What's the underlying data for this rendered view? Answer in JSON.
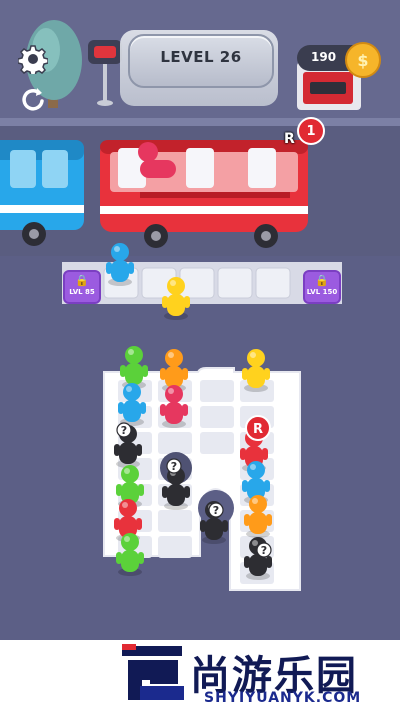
{
  "hud": {
    "level_label": "LEVEL 26",
    "coins": "190",
    "coin_symbol": "$",
    "settings_icon": "gear-icon",
    "restart_icon": "restart-icon"
  },
  "bus": {
    "badge_count": "1",
    "badge_type": "R",
    "color": "#e8323c"
  },
  "waiting_slots": {
    "locked_left_label": "LVL 85",
    "locked_right_label": "LVL 150",
    "lock_icon": "lock-icon"
  },
  "board": {
    "hidden_marker": "?",
    "reserved_marker": "R"
  },
  "colors": {
    "red": "#e8323c",
    "blue": "#28a7ea",
    "green": "#5bd13a",
    "yellow": "#ffd21e",
    "orange": "#ff9b1a",
    "pink": "#e6375f",
    "black": "#2d2d32",
    "lock": "#9b5be0"
  },
  "watermark": {
    "cn": "尚游乐园",
    "en": "SHYIYUANYK.COM"
  }
}
